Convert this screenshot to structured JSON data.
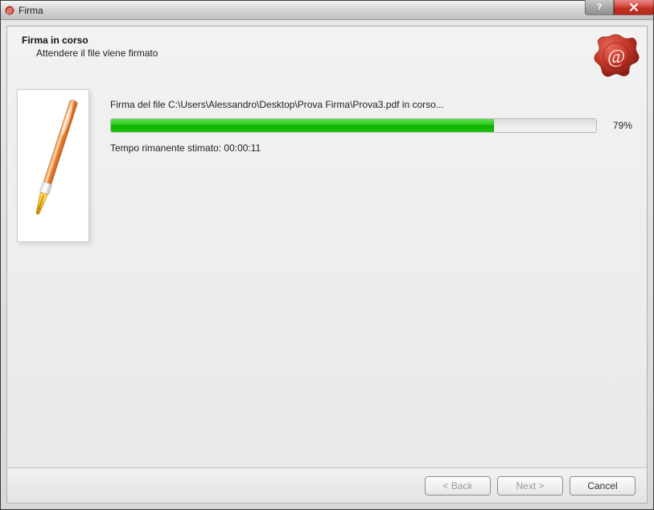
{
  "window": {
    "title": "Firma"
  },
  "header": {
    "heading": "Firma in corso",
    "subheading": "Attendere il file viene firmato"
  },
  "main": {
    "status_label": "Firma del file C:\\Users\\Alessandro\\Desktop\\Prova Firma\\Prova3.pdf in corso...",
    "progress_percent": 79,
    "progress_percent_label": "79%",
    "time_label": "Tempo rimanente stimato: 00:00:11"
  },
  "footer": {
    "back_label": "< Back",
    "next_label": "Next >",
    "cancel_label": "Cancel"
  }
}
